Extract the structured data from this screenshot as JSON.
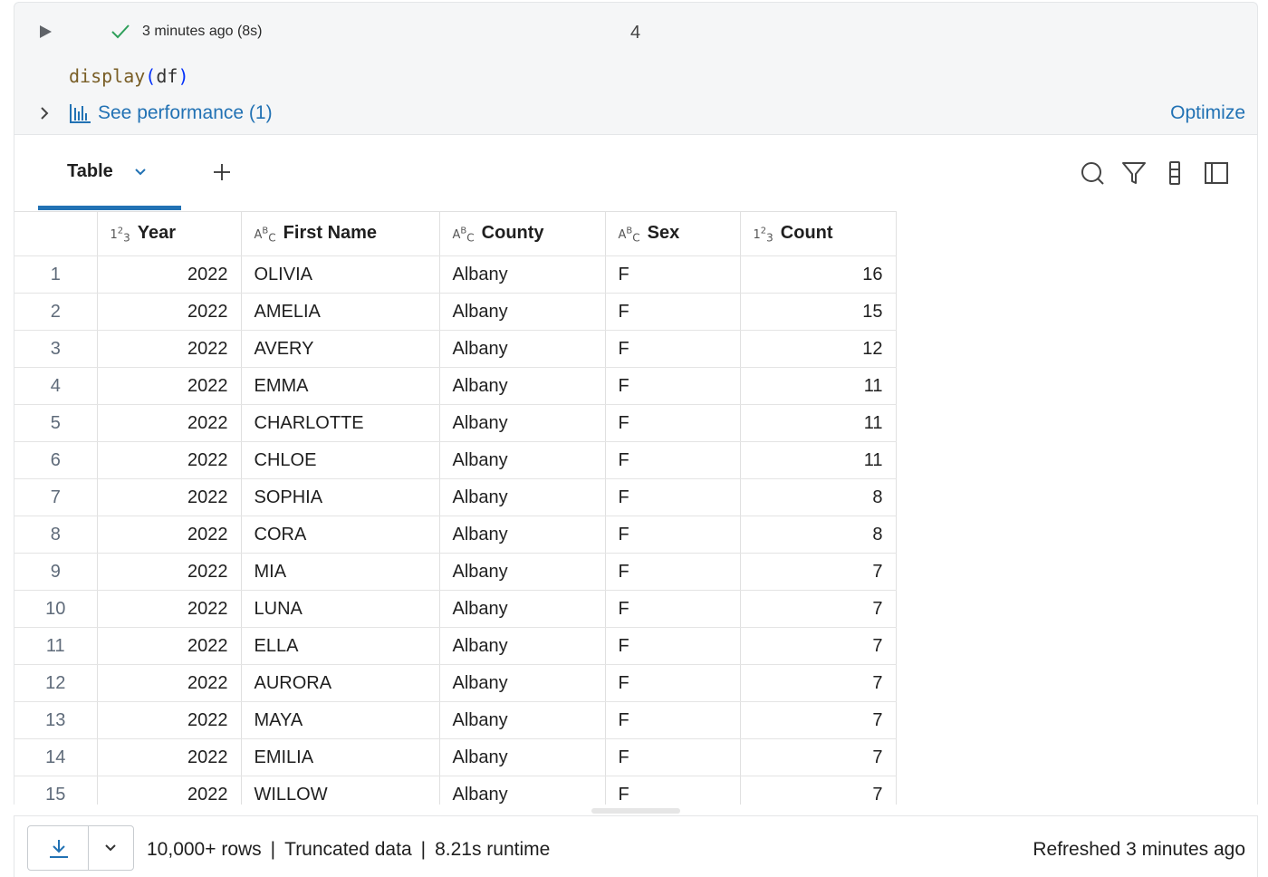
{
  "cell": {
    "status": "3 minutes ago (8s)",
    "cell_number": "4",
    "code_fn": "display",
    "code_open": "(",
    "code_arg": "df",
    "code_close": ")",
    "performance_label": "See performance (1)",
    "optimize_label": "Optimize"
  },
  "toolbar": {
    "tab_label": "Table",
    "add_label": "+"
  },
  "table": {
    "columns": [
      {
        "type": "123",
        "label": "Year"
      },
      {
        "type": "ABC",
        "label": "First Name"
      },
      {
        "type": "ABC",
        "label": "County"
      },
      {
        "type": "ABC",
        "label": "Sex"
      },
      {
        "type": "123",
        "label": "Count"
      }
    ],
    "rows": [
      [
        "1",
        "2022",
        "OLIVIA",
        "Albany",
        "F",
        "16"
      ],
      [
        "2",
        "2022",
        "AMELIA",
        "Albany",
        "F",
        "15"
      ],
      [
        "3",
        "2022",
        "AVERY",
        "Albany",
        "F",
        "12"
      ],
      [
        "4",
        "2022",
        "EMMA",
        "Albany",
        "F",
        "11"
      ],
      [
        "5",
        "2022",
        "CHARLOTTE",
        "Albany",
        "F",
        "11"
      ],
      [
        "6",
        "2022",
        "CHLOE",
        "Albany",
        "F",
        "11"
      ],
      [
        "7",
        "2022",
        "SOPHIA",
        "Albany",
        "F",
        "8"
      ],
      [
        "8",
        "2022",
        "CORA",
        "Albany",
        "F",
        "8"
      ],
      [
        "9",
        "2022",
        "MIA",
        "Albany",
        "F",
        "7"
      ],
      [
        "10",
        "2022",
        "LUNA",
        "Albany",
        "F",
        "7"
      ],
      [
        "11",
        "2022",
        "ELLA",
        "Albany",
        "F",
        "7"
      ],
      [
        "12",
        "2022",
        "AURORA",
        "Albany",
        "F",
        "7"
      ],
      [
        "13",
        "2022",
        "MAYA",
        "Albany",
        "F",
        "7"
      ],
      [
        "14",
        "2022",
        "EMILIA",
        "Albany",
        "F",
        "7"
      ],
      [
        "15",
        "2022",
        "WILLOW",
        "Albany",
        "F",
        "7"
      ]
    ]
  },
  "footer": {
    "rows_info": "10,000+ rows",
    "truncated": "Truncated data",
    "runtime": "8.21s runtime",
    "separator": "|",
    "refreshed": "Refreshed 3 minutes ago"
  },
  "colors": {
    "accent": "#2272b4",
    "success": "#2e9f5a",
    "header_bg": "#f5f6f7"
  },
  "icons": [
    "run-icon",
    "check-icon",
    "chevron-right-icon",
    "bar-chart-icon",
    "chevron-down-icon",
    "plus-icon",
    "search-icon",
    "filter-icon",
    "column-settings-icon",
    "sidebar-panel-icon",
    "download-icon"
  ]
}
